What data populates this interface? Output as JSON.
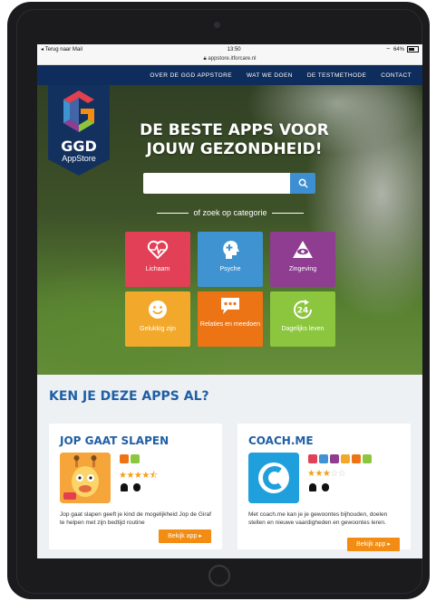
{
  "status": {
    "back_label": "◂ Terug naar Mail",
    "time": "13:50",
    "battery": "64%"
  },
  "url": "appstore.itforcare.nl",
  "nav": {
    "items": [
      "OVER DE GGD APPSTORE",
      "WAT WE DOEN",
      "DE TESTMETHODE",
      "CONTACT"
    ]
  },
  "logo": {
    "line1": "GGD",
    "line2": "AppStore"
  },
  "hero": {
    "headline_1": "DE BESTE APPS VOOR",
    "headline_2": "JOUW GEZONDHEID!",
    "search_placeholder": "",
    "category_text": "of zoek op categorie"
  },
  "categories": [
    {
      "label": "Lichaam",
      "color": "#e24056",
      "icon": "heart-pulse-icon"
    },
    {
      "label": "Psyche",
      "color": "#3f93d1",
      "icon": "head-plus-icon"
    },
    {
      "label": "Zingeving",
      "color": "#8e3d91",
      "icon": "eye-triangle-icon"
    },
    {
      "label": "Gelukkig zijn",
      "color": "#f2a92b",
      "icon": "smiley-icon"
    },
    {
      "label": "Relaties en meedoen",
      "color": "#ed7414",
      "icon": "chat-dots-icon"
    },
    {
      "label": "Dagelijks leven",
      "color": "#8cc63e",
      "icon": "clock-24-icon"
    }
  ],
  "apps_section": {
    "title": "KEN JE DEZE APPS AL?",
    "cards": [
      {
        "name": "JOP GAAT SLAPEN",
        "rating": 4.5,
        "description": "Jop gaat slapen geeft je kind de mogelijkheid Jop de Giraf te helpen met zijn bedtijd routine",
        "button": "Bekijk app",
        "badge_colors": [
          "#ed7414",
          "#8cc63e"
        ]
      },
      {
        "name": "COACH.ME",
        "rating": 3,
        "description": "Met coach.me kan je je gewoontes bijhouden, doelen stellen en nieuwe vaardigheden en gewoontes leren.",
        "button": "Bekijk app",
        "badge_colors": [
          "#e24056",
          "#3f93d1",
          "#8e3d91",
          "#f2a92b",
          "#ed7414",
          "#8cc63e"
        ]
      }
    ]
  }
}
